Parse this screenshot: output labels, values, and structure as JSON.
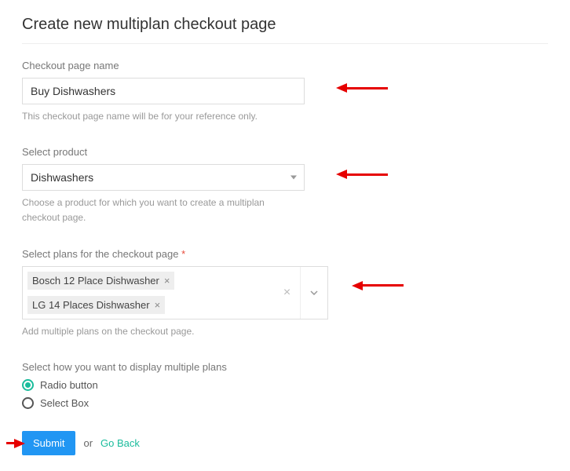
{
  "page": {
    "title": "Create new multiplan checkout page"
  },
  "checkoutName": {
    "label": "Checkout page name",
    "value": "Buy Dishwashers",
    "help": "This checkout page name will be for your reference only."
  },
  "product": {
    "label": "Select product",
    "value": "Dishwashers",
    "help": "Choose a product for which you want to create a multiplan checkout page."
  },
  "plans": {
    "label": "Select plans for the checkout page",
    "required": "*",
    "tags": [
      "Bosch 12 Place Dishwasher",
      "LG 14 Places Dishwasher"
    ],
    "help": "Add multiple plans on the checkout page."
  },
  "display": {
    "label": "Select how you want to display multiple plans",
    "options": [
      {
        "label": "Radio button",
        "checked": true
      },
      {
        "label": "Select Box",
        "checked": false
      }
    ]
  },
  "actions": {
    "submit": "Submit",
    "or": "or",
    "goBack": "Go Back"
  }
}
